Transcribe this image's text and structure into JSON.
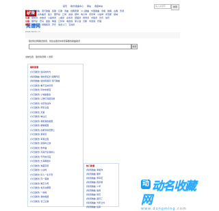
{
  "logo": {
    "badge": "歌谱",
    "word": "简谱网",
    "url": "www.jianpu.cn"
  },
  "topnav": [
    "首页",
    "歌谱/歌曲中心",
    "网站",
    "收藏本站"
  ],
  "topsearch": {
    "placeholder": "输入关键字",
    "button": "搜索"
  },
  "links": {
    "rows": [
      {
        "label": "简谱",
        "items": [
          "儿童歌曲",
          "流行歌曲",
          "民歌",
          "红歌",
          "戏曲",
          "经典老歌",
          "少儿歌曲",
          "外国歌曲",
          "合唱",
          "独唱",
          "古典",
          "影视"
        ]
      },
      {
        "label": "",
        "items": [
          "二胡曲谱",
          "古筝曲谱",
          "笛子",
          "葫芦丝",
          "口琴",
          "吉他",
          "钢琴",
          "电子琴",
          "手风琴",
          "小提琴",
          "萨克斯",
          "唢呐"
        ]
      },
      {
        "label": "乐谱",
        "items": [
          "钢琴谱",
          "吉他谱",
          "小提琴谱",
          "二胡谱",
          "古筝谱",
          "琵琶谱",
          "扬琴谱",
          "长笛谱",
          "管乐",
          "弦乐"
        ]
      },
      {
        "label": "乐器",
        "items": [
          "葫芦丝",
          "巴乌",
          "竖笛",
          "陶笛",
          "口风琴",
          "电吉他",
          "架子鼓",
          "贝斯",
          "木吉他",
          "乐理"
        ]
      },
      {
        "label": "教程",
        "items": [
          "乐理知识",
          "视唱练耳",
          "声乐",
          "简谱入门",
          "五线谱"
        ]
      }
    ]
  },
  "search": {
    "hint": "歌谱简谱网歌谱搜索，供您在歌谱中搜索需要的歌曲歌谱",
    "button": "搜索"
  },
  "crumbs": "当前位置：歌谱简谱网 > 搜索",
  "panel": {
    "header": "最新歌谱",
    "items": [
      "[今日歌谱] 最好的时光",
      "[简谱歌曲] 我的老班长 经典怀旧",
      "[简谱歌曲] 最炫民族风 流行歌曲",
      "[今日歌谱] 看不见的风景",
      "[今日歌谱] 风中的承诺",
      "[今日歌谱] 小城故事多",
      "[今日歌谱] 让我们荡起双桨",
      "[今日歌谱] 北京欢迎你",
      "[今日歌谱] 草原之夜",
      "[今日歌谱] 天路",
      "[今日歌谱] 映山红",
      "[今日歌谱] 我和我的祖国",
      "[今日歌谱] 歌唱祖国",
      "[今日歌谱] 在希望的田野上",
      "[今日歌谱] 茉莉花",
      "[今日歌谱] 军港之夜",
      "[今日歌谱] 鼓浪屿之波",
      "[今日歌谱] 牧羊曲",
      "[今日歌谱] 月亮代表我的心",
      "[今日歌谱] 弯弯的月亮",
      "[今日歌谱] 大海啊故乡",
      "[今日歌谱] 青藏高原",
      "[今日歌谱] 小白杨",
      "[今日歌谱] 好人一生平安",
      "[今日歌谱] 同一首歌",
      "[今日歌谱] 难忘今宵",
      "[今日歌谱] 春天在哪里",
      "[今日歌谱] 一剪梅",
      "[今日歌谱] 我的祖国",
      "[今日歌谱] 长江之歌"
    ]
  },
  "hot": {
    "header": "热门歌谱",
    "items": [
      "[简谱歌曲] 我和你",
      "[简谱歌曲] 童年",
      "[简谱歌曲] 萱草花",
      "[简谱歌曲] 孤勇者",
      "[简谱歌曲] 少年",
      "[简谱歌曲] 稻香",
      "[简谱歌曲] 晴天",
      "[简谱歌曲] 起风了",
      "[简谱歌曲] 光年之外",
      "[简谱歌曲] 后来"
    ]
  },
  "watermark": {
    "big": "动名收藏网",
    "small": "www.dongming.com"
  }
}
